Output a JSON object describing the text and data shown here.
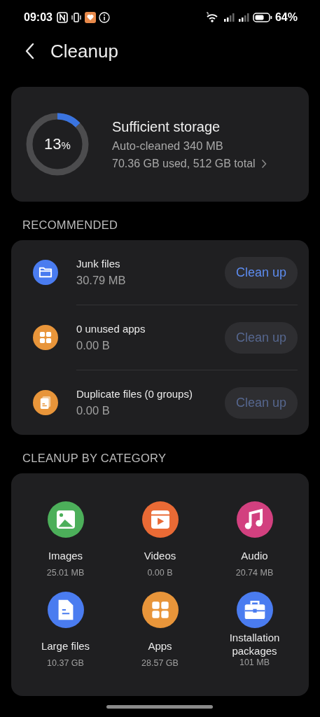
{
  "status_bar": {
    "time": "09:03",
    "battery": "64%"
  },
  "header": {
    "title": "Cleanup"
  },
  "storage": {
    "level": 0.13,
    "percent": "13",
    "unit": "%",
    "title": "Sufficient storage",
    "auto_cleaned": "Auto-cleaned 340 MB",
    "usage": "70.36 GB used, 512 GB total"
  },
  "recommended": {
    "heading": "RECOMMENDED",
    "items": [
      {
        "kind": "folder",
        "color": "#4a7cf0",
        "title": "Junk files",
        "size": "30.79 MB",
        "button": "Clean up",
        "disabled": false
      },
      {
        "kind": "apps",
        "color": "#e8953a",
        "title": "0 unused apps",
        "size": "0.00 B",
        "button": "Clean up",
        "disabled": true
      },
      {
        "kind": "duplicate",
        "color": "#e8953a",
        "title": "Duplicate files (0 groups)",
        "size": "0.00 B",
        "button": "Clean up",
        "disabled": true
      }
    ]
  },
  "categories": {
    "heading": "CLEANUP BY CATEGORY",
    "items": [
      {
        "kind": "image",
        "color": "#4caf5a",
        "label": "Images",
        "size": "25.01 MB"
      },
      {
        "kind": "video",
        "color": "#e96a35",
        "label": "Videos",
        "size": "0.00 B"
      },
      {
        "kind": "music",
        "color": "#d2407f",
        "label": "Audio",
        "size": "20.74 MB"
      },
      {
        "kind": "file",
        "color": "#4a7cf0",
        "label": "Large files",
        "size": "10.37 GB"
      },
      {
        "kind": "apps",
        "color": "#e8953a",
        "label": "Apps",
        "size": "28.57 GB"
      },
      {
        "kind": "package",
        "color": "#4a7cf0",
        "label": "Installation packages",
        "size": "101 MB"
      }
    ]
  }
}
